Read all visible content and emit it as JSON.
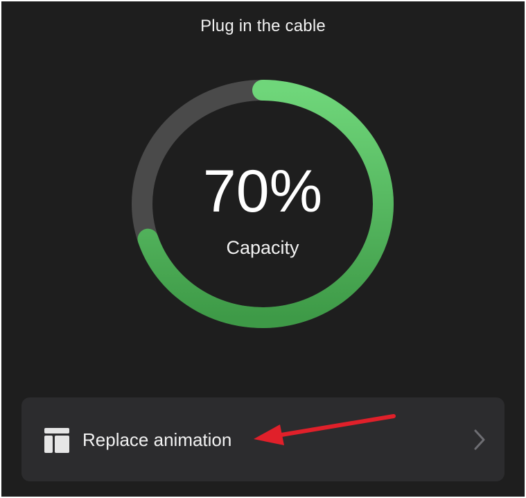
{
  "screen": {
    "title": "Plug in the cable"
  },
  "capacity": {
    "percent_text": "70%",
    "label": "Capacity",
    "fraction": 0.7
  },
  "replace_option": {
    "label": "Replace animation",
    "icon": "layout-template-icon",
    "chevron_icon": "chevron-right-icon"
  },
  "annotation": {
    "arrow_icon": "red-arrow-icon"
  },
  "colors": {
    "background": "#1e1e1e",
    "card": "#2c2c2e",
    "ring_track": "#4a4a4a",
    "ring_fill_top": "#6fd67a",
    "ring_fill_bottom": "#3e9a47",
    "arrow": "#e0202a"
  }
}
